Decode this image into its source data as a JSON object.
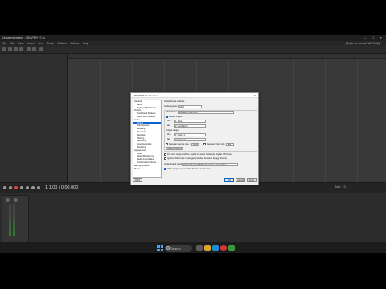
{
  "app": {
    "window_title": "[Unsaved project] - REAPER v7.xx",
    "window_controls": "–  ☐  ✕",
    "menu": [
      "File",
      "Edit",
      "View",
      "Insert",
      "Item",
      "Track",
      "Options",
      "Actions",
      "Help"
    ],
    "menu_right": "[Single file format: WAV 24bit]"
  },
  "transport": {
    "time": "1.1.00 / 0:00.000",
    "rate": "Rate: 1.0"
  },
  "mixer": {
    "master_label": "MASTER"
  },
  "dialog": {
    "title": "REAPER Preferences",
    "close": "✕",
    "tree": [
      {
        "label": "General",
        "level": 0
      },
      {
        "label": "Paths",
        "level": 1
      },
      {
        "label": "Keyboard/Multitouch",
        "level": 1
      },
      {
        "label": "Project",
        "level": 0
      },
      {
        "label": "Track/Send Defaults",
        "level": 1
      },
      {
        "label": "Media Item Defaults",
        "level": 1
      },
      {
        "label": "Audio",
        "level": 0
      },
      {
        "label": "Device",
        "level": 1,
        "selected": true
      },
      {
        "label": "MIDI Devices",
        "level": 1
      },
      {
        "label": "Buffering",
        "level": 1
      },
      {
        "label": "Mute/Solo",
        "level": 1
      },
      {
        "label": "Playback",
        "level": 1
      },
      {
        "label": "Seeking",
        "level": 1
      },
      {
        "label": "Recording",
        "level": 1
      },
      {
        "label": "Loop Recording",
        "level": 1
      },
      {
        "label": "Rendering",
        "level": 1
      },
      {
        "label": "Appearance",
        "level": 0
      },
      {
        "label": "Media",
        "level": 1
      },
      {
        "label": "Peaks/Waveforms",
        "level": 1
      },
      {
        "label": "Fades/Crossfades",
        "level": 1
      },
      {
        "label": "Track Control Panels",
        "level": 1
      },
      {
        "label": "Editing Behavior",
        "level": 0
      },
      {
        "label": "Media",
        "level": 0
      }
    ],
    "section_title": "Audio device settings",
    "audio_system_label": "Audio system:",
    "audio_system_value": "ASIO",
    "asio_driver_label": "ASIO Driver:",
    "asio_driver_value": "Focusrite USB ASIO",
    "enable_inputs_label": "Enable inputs:",
    "first_label": "first",
    "first_input_value": "1: Input 1",
    "last_label": "last",
    "last_input_value": "2: Loopback 2",
    "output_range_label": "Output range:",
    "first_output_value": "1: Output 1",
    "last_output_value": "2: Output 2",
    "request_samplerate_label": "Request sample rate:",
    "samplerate_value": "48000",
    "request_blocksize_label": "Request block size:",
    "blocksize_value": "256",
    "asio_config_button": "ASIO Configuration...",
    "pre_zero_label": "Pre-zero output buffers, useful on some hardware (higher CPU use)",
    "ignore_asio_label": "Ignore ASIO reset messages (needed for some buggy drivers)",
    "audio_thread_label": "Audio thread priority:",
    "audio_thread_value": "ASIO Default / MMCSS Pro Audio / Time Critical",
    "allow_projects_label": "Allow projects to override device sample rate",
    "find_button": "Find",
    "ok_button": "OK",
    "cancel_button": "Cancel",
    "apply_button": "Apply"
  },
  "taskbar": {
    "search_placeholder": "Search"
  }
}
